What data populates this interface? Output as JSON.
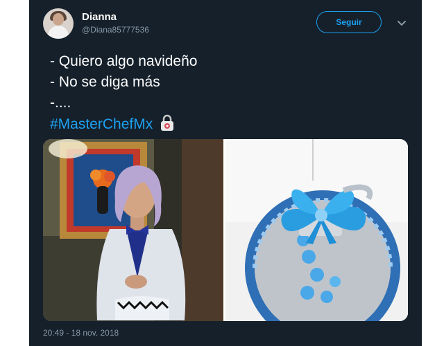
{
  "user": {
    "name": "Dianna",
    "handle": "@Diana85777536"
  },
  "actions": {
    "follow_label": "Seguir"
  },
  "tweet": {
    "lines": [
      "- Quiero algo navideño",
      "- No se diga más",
      "-...."
    ],
    "hashtag": "#MasterChefMx"
  },
  "timestamp": "20:49 - 18 nov. 2018",
  "colors": {
    "background": "#15202b",
    "accent": "#1da1f2",
    "muted_text": "#8899a6"
  },
  "icons": {
    "more": "chevron-down-icon",
    "emoji": "lock-icon"
  }
}
